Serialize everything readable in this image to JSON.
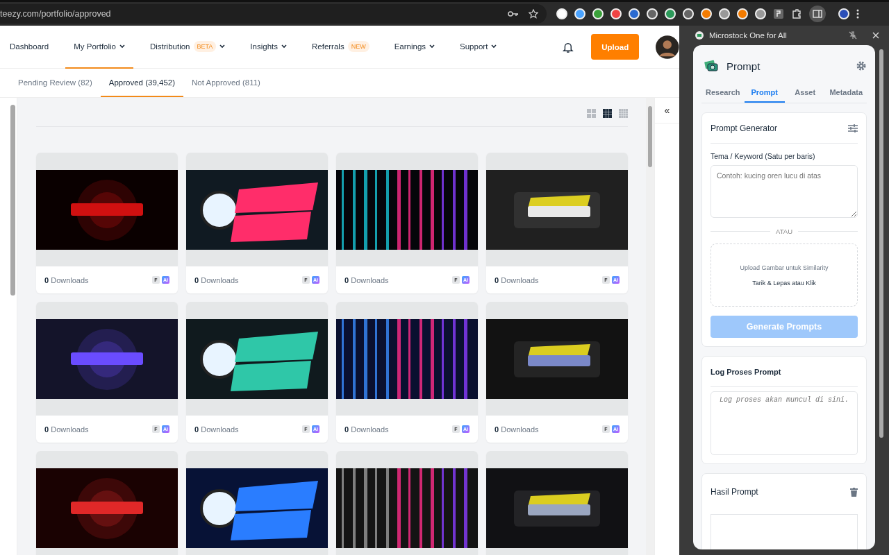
{
  "browser": {
    "url": "teezy.com/portfolio/approved"
  },
  "nav": {
    "items": [
      {
        "label": "Dashboard",
        "selected": false,
        "menu": false
      },
      {
        "label": "My Portfolio",
        "selected": true,
        "menu": true
      },
      {
        "label": "Distribution",
        "selected": false,
        "menu": true,
        "badge": "BETA"
      },
      {
        "label": "Insights",
        "selected": false,
        "menu": true
      },
      {
        "label": "Referrals",
        "selected": false,
        "menu": false,
        "badge": "NEW"
      },
      {
        "label": "Earnings",
        "selected": false,
        "menu": true
      },
      {
        "label": "Support",
        "selected": false,
        "menu": true
      }
    ],
    "upload": "Upload"
  },
  "tabs": [
    {
      "label": "Pending Review (82)",
      "selected": false
    },
    {
      "label": "Approved (39,452)",
      "selected": true
    },
    {
      "label": "Not Approved (811)",
      "selected": false
    }
  ],
  "view_modes": [
    {
      "kind": "large",
      "selected": false
    },
    {
      "kind": "medium",
      "selected": true
    },
    {
      "kind": "small",
      "selected": false
    }
  ],
  "collapse": "«",
  "cards": [
    {
      "kind": "picture",
      "count": "0",
      "label": "Downloads",
      "badges": [
        {
          "label": "F",
          "kind": "plain"
        },
        {
          "label": "Ai",
          "kind": "gradient"
        }
      ]
    },
    {
      "kind": "picture",
      "count": "0",
      "label": "Downloads",
      "badges": [
        {
          "label": "F",
          "kind": "plain"
        },
        {
          "label": "Ai",
          "kind": "gradient"
        }
      ]
    },
    {
      "kind": "picture",
      "count": "0",
      "label": "Downloads",
      "badges": [
        {
          "label": "F",
          "kind": "plain"
        },
        {
          "label": "Ai",
          "kind": "gradient"
        }
      ]
    },
    {
      "kind": "picture",
      "count": "0",
      "label": "Downloads",
      "badges": [
        {
          "label": "F",
          "kind": "plain"
        },
        {
          "label": "Ai",
          "kind": "gradient"
        }
      ]
    },
    {
      "kind": "picture",
      "count": "0",
      "label": "Downloads",
      "badges": [
        {
          "label": "F",
          "kind": "plain"
        },
        {
          "label": "Ai",
          "kind": "gradient"
        }
      ]
    },
    {
      "kind": "picture",
      "count": "0",
      "label": "Downloads",
      "badges": [
        {
          "label": "F",
          "kind": "plain"
        },
        {
          "label": "Ai",
          "kind": "gradient"
        }
      ]
    },
    {
      "kind": "picture",
      "count": "0",
      "label": "Downloads",
      "badges": [
        {
          "label": "F",
          "kind": "plain"
        },
        {
          "label": "Ai",
          "kind": "gradient"
        }
      ]
    },
    {
      "kind": "picture",
      "count": "0",
      "label": "Downloads",
      "badges": [
        {
          "label": "F",
          "kind": "plain"
        },
        {
          "label": "Ai",
          "kind": "gradient"
        }
      ]
    },
    {
      "kind": "picture"
    },
    {
      "kind": "picture"
    },
    {
      "kind": "picture"
    },
    {
      "kind": "picture"
    }
  ],
  "side_panel": {
    "title": "Microstock One for All",
    "heading": "Prompt",
    "tabs": [
      {
        "label": "Research",
        "selected": false
      },
      {
        "label": "Prompt",
        "selected": true
      },
      {
        "label": "Asset",
        "selected": false
      },
      {
        "label": "Metadata",
        "selected": false
      }
    ],
    "generator": {
      "title": "Prompt Generator",
      "field_label": "Tema / Keyword (Satu per baris)",
      "placeholder": "Contoh: kucing oren lucu di atas",
      "separator": "ATAU",
      "drop_title": "Upload Gambar untuk Similarity",
      "drop_hint": "Tarik & Lepas atau Klik",
      "button": "Generate Prompts",
      "button_disabled": true
    },
    "log": {
      "title": "Log Proses Prompt",
      "placeholder": "Log proses akan muncul di sini."
    },
    "result": {
      "title": "Hasil Prompt"
    }
  }
}
